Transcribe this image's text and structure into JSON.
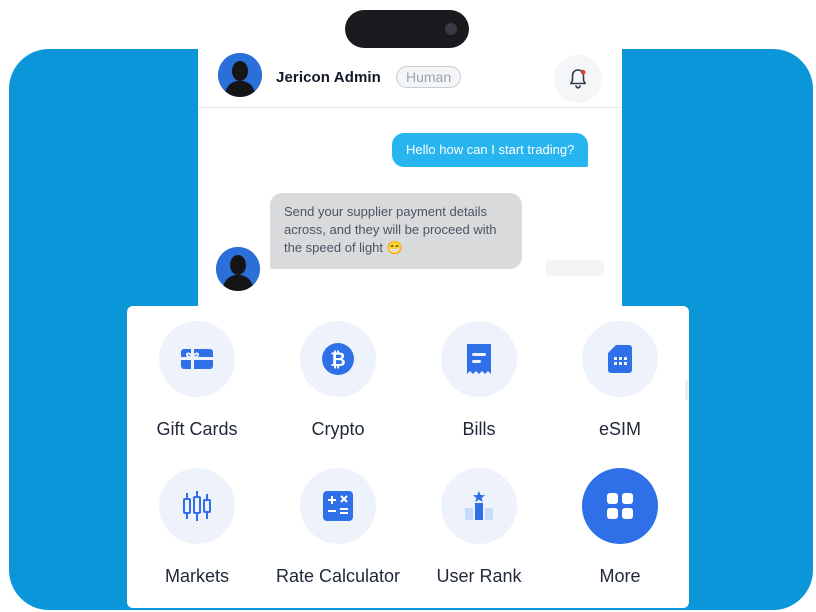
{
  "colors": {
    "brand_blue": "#0b96d9",
    "accent": "#2f6fe8",
    "outgoing_bubble": "#27b5f0",
    "incoming_bubble": "#d9dadc",
    "notification_dot": "#e53935"
  },
  "chat": {
    "header": {
      "name": "Jericon Admin",
      "role_badge": "Human",
      "avatar_icon": "user-avatar",
      "notification_icon": "bell-icon",
      "has_unread": true
    },
    "messages": [
      {
        "direction": "outgoing",
        "text": "Hello how can I start trading?"
      },
      {
        "direction": "incoming",
        "text": "Send your supplier payment details across, and they will be proceed with the speed of light 😁"
      }
    ]
  },
  "menu": {
    "items": [
      {
        "label": "Gift Cards",
        "icon": "gift-card-icon"
      },
      {
        "label": "Crypto",
        "icon": "bitcoin-icon"
      },
      {
        "label": "Bills",
        "icon": "receipt-icon"
      },
      {
        "label": "eSIM",
        "icon": "sim-card-icon"
      },
      {
        "label": "Markets",
        "icon": "candlestick-chart-icon"
      },
      {
        "label": "Rate Calculator",
        "icon": "calculator-icon"
      },
      {
        "label": "User Rank",
        "icon": "rank-podium-icon"
      },
      {
        "label": "More",
        "icon": "grid-icon"
      }
    ]
  }
}
